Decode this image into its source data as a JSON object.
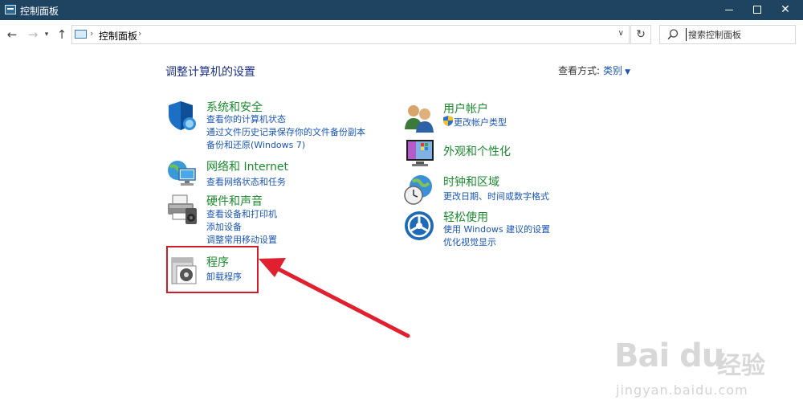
{
  "window": {
    "title": "控制面板"
  },
  "address": {
    "crumb": "控制面板",
    "sep": "›",
    "search_placeholder": "搜索控制面板"
  },
  "main": {
    "heading": "调整计算机的设置",
    "view_by_label": "查看方式:",
    "view_by_value": "类别"
  },
  "categories_left": [
    {
      "title": "系统和安全",
      "icon": "system-security-shield-icon",
      "links": [
        "查看你的计算机状态",
        "通过文件历史记录保存你的文件备份副本",
        "备份和还原(Windows 7)"
      ]
    },
    {
      "title": "网络和 Internet",
      "icon": "network-globe-icon",
      "links": [
        "查看网络状态和任务"
      ]
    },
    {
      "title": "硬件和声音",
      "icon": "printer-speaker-icon",
      "links": [
        "查看设备和打印机",
        "添加设备",
        "调整常用移动设置"
      ]
    },
    {
      "title": "程序",
      "icon": "programs-disc-icon",
      "links": [
        "卸载程序"
      ]
    }
  ],
  "categories_right": [
    {
      "title": "用户帐户",
      "icon": "user-accounts-icon",
      "links": [
        "更改帐户类型"
      ]
    },
    {
      "title": "外观和个性化",
      "icon": "appearance-monitor-icon",
      "links": []
    },
    {
      "title": "时钟和区域",
      "icon": "clock-globe-icon",
      "links": [
        "更改日期、时间或数字格式"
      ]
    },
    {
      "title": "轻松使用",
      "icon": "ease-of-access-icon",
      "links": [
        "使用 Windows 建议的设置",
        "优化视觉显示"
      ]
    }
  ],
  "watermark": {
    "main": "Bai du",
    "cn": "经验",
    "url": "jingyan.baidu.com"
  },
  "colors": {
    "titlebar": "#1e4461",
    "category_title": "#1a8a2e",
    "link": "#1a56b8",
    "highlight": "#d11a2a"
  }
}
